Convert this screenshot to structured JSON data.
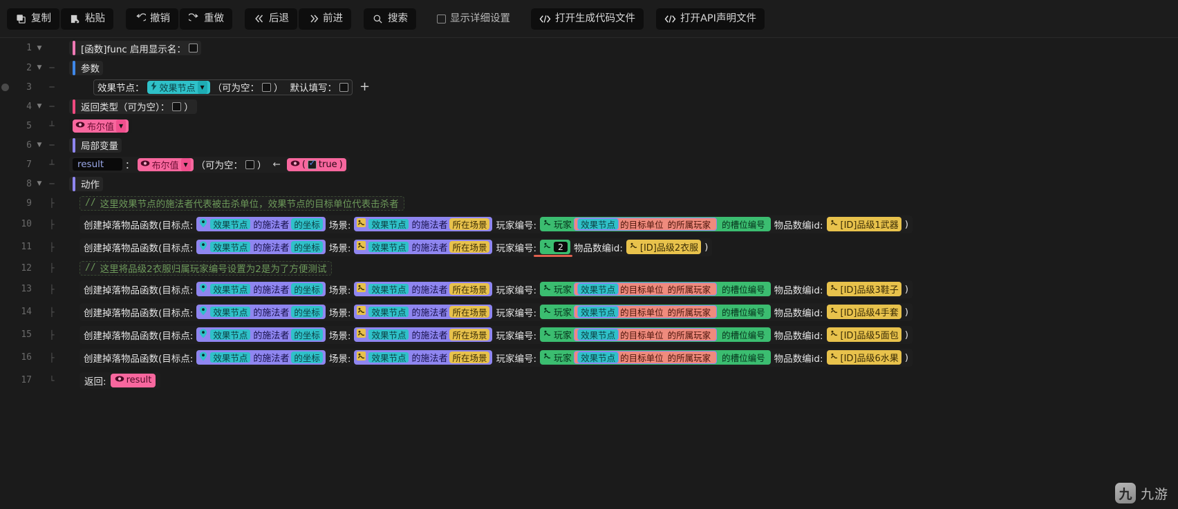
{
  "toolbar": {
    "copy": "复制",
    "paste": "粘贴",
    "undo": "撤销",
    "redo": "重做",
    "back": "后退",
    "forward": "前进",
    "search": "搜索",
    "show_detail_settings": "显示详细设置",
    "open_generated_code_file": "打开生成代码文件",
    "open_api_declaration_file": "打开API声明文件"
  },
  "colors": {
    "accent_pink": "#f8679e",
    "accent_blue": "#3f87e8",
    "accent_purple": "#8f86f0",
    "chip_cyan": "#2fc1c9",
    "chip_purple": "#8f86f0",
    "chip_yellow": "#e8c24c",
    "chip_green": "#3bbd70",
    "chip_salmon": "#ef8b7d",
    "chip_pink": "#f8679e",
    "comment_green": "#6d9a5a",
    "underline_red": "#e0604e"
  },
  "line_numbers": [
    1,
    2,
    3,
    4,
    5,
    6,
    7,
    8,
    9,
    10,
    11,
    12,
    13,
    14,
    15,
    16,
    17
  ],
  "code": {
    "l1": {
      "prefix": "[函数]func",
      "label": "启用显示名：",
      "checkbox": false
    },
    "l2": {
      "label": "参数"
    },
    "l3": {
      "param_name": "效果节点：",
      "type_chip": "效果节点",
      "nullable_label": "（可为空：",
      "nullable_close": "）",
      "default_label": "默认填写：",
      "add": "+"
    },
    "l4": {
      "label": "返回类型（可为空）：",
      "close": "）"
    },
    "l5": {
      "type": "布尔值"
    },
    "l6": {
      "label": "局部变量"
    },
    "l7": {
      "var_name": "result",
      "colon": "：",
      "type": "布尔值",
      "nullable_label": "（可为空：",
      "nullable_close": "）",
      "arrow": "←",
      "value": "true",
      "value_open": "(",
      "value_close": ")"
    },
    "l8": {
      "label": "动作"
    },
    "l9": {
      "comment": "这里效果节点的施法者代表被击杀单位，效果节点的目标单位代表击杀者"
    },
    "l12": {
      "comment": "这里将品级2衣服归属玩家编号设置为2是为了方便测试"
    },
    "l17": {
      "label": "返回:",
      "value": "result"
    }
  },
  "drop_call": {
    "fn_label": "创建掉落物品函数(目标点:",
    "target_node": "效果节点",
    "target_suffix_caster": "的施法者",
    "target_suffix_coord": "的坐标",
    "scene_label": "场景:",
    "scene_suffix_in": "所在场景",
    "player_label": "玩家编号:",
    "player_chip": "玩家",
    "target_unit_suffix": "的目标单位",
    "owner_suffix": "的所属玩家",
    "slot_suffix": "的槽位编号",
    "item_label": "物品数编id:",
    "close_paren": ")"
  },
  "rows": [
    {
      "line": 10,
      "item_id": "[ID]品级1武器",
      "player_mode": "expr"
    },
    {
      "line": 11,
      "item_id": "[ID]品级2衣服",
      "player_mode": "literal",
      "player_value": "2"
    },
    {
      "line": 13,
      "item_id": "[ID]品级3鞋子",
      "player_mode": "expr"
    },
    {
      "line": 14,
      "item_id": "[ID]品级4手套",
      "player_mode": "expr"
    },
    {
      "line": 15,
      "item_id": "[ID]品级5面包",
      "player_mode": "expr"
    },
    {
      "line": 16,
      "item_id": "[ID]品级6水果",
      "player_mode": "expr"
    }
  ],
  "watermark": {
    "logo": "九",
    "text": "九游"
  }
}
